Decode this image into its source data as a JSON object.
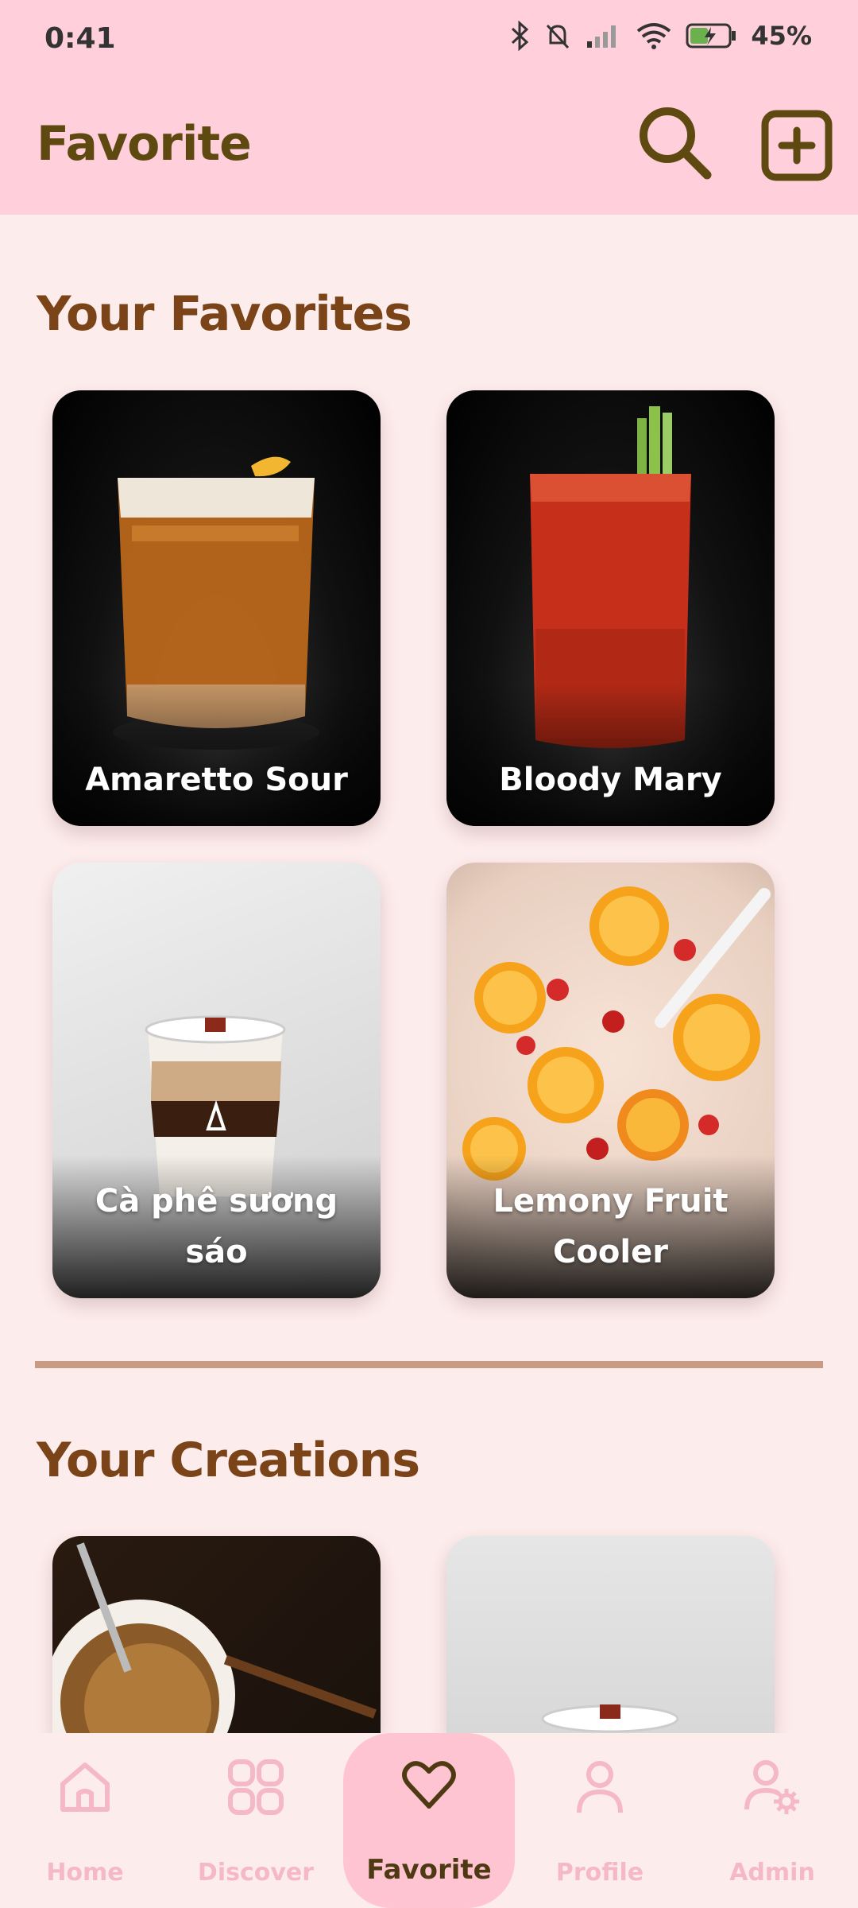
{
  "status_bar": {
    "time": "0:41",
    "battery": "45%"
  },
  "app_bar": {
    "title": "Favorite"
  },
  "favorites": {
    "title": "Your Favorites",
    "items": [
      {
        "label": "Amaretto Sour"
      },
      {
        "label": "Bloody Mary"
      },
      {
        "label": "Cà phê sương sáo"
      },
      {
        "label": "Lemony Fruit Cooler"
      }
    ]
  },
  "creations": {
    "title": "Your Creations"
  },
  "nav": {
    "items": [
      {
        "label": "Home",
        "icon": "home-icon"
      },
      {
        "label": "Discover",
        "icon": "grid-icon"
      },
      {
        "label": "Favorite",
        "icon": "heart-icon",
        "active": true
      },
      {
        "label": "Profile",
        "icon": "person-icon"
      },
      {
        "label": "Admin",
        "icon": "admin-icon"
      }
    ]
  },
  "colors": {
    "header": "#ffd0dc",
    "accent": "#5e4a10",
    "section_title": "#7a4418",
    "nav_inactive": "#f5b8c8",
    "nav_active_bg": "#ffc4d2"
  }
}
